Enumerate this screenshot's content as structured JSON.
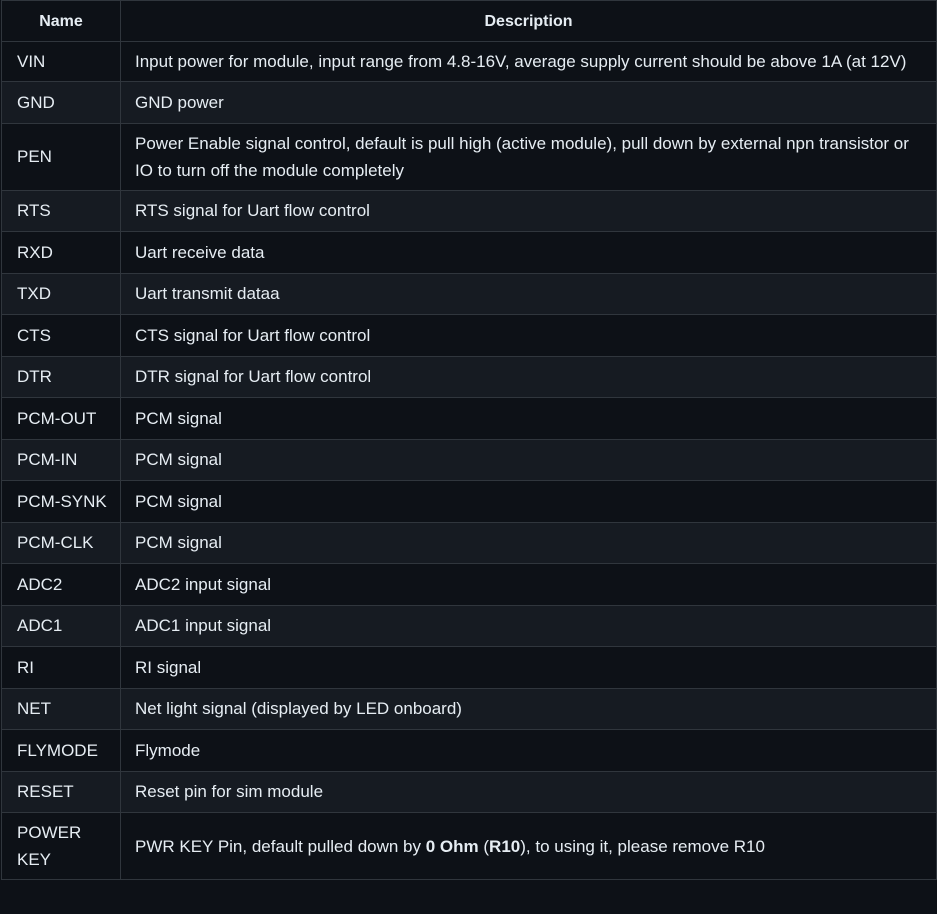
{
  "table": {
    "headers": {
      "name": "Name",
      "description": "Description"
    },
    "rows": [
      {
        "name": "VIN",
        "description": "Input power for module, input range from 4.8-16V, average supply current should be above 1A (at 12V)"
      },
      {
        "name": "GND",
        "description": "GND power"
      },
      {
        "name": "PEN",
        "description": "Power Enable signal control, default is pull high (active module), pull down by external npn transistor or IO to turn off the module completely"
      },
      {
        "name": "RTS",
        "description": "RTS signal for Uart flow control"
      },
      {
        "name": "RXD",
        "description": "Uart receive data"
      },
      {
        "name": "TXD",
        "description": "Uart transmit dataa"
      },
      {
        "name": "CTS",
        "description": "CTS signal for Uart flow control"
      },
      {
        "name": "DTR",
        "description": "DTR signal for Uart flow control"
      },
      {
        "name": "PCM-OUT",
        "description": "PCM signal"
      },
      {
        "name": "PCM-IN",
        "description": "PCM signal"
      },
      {
        "name": "PCM-SYNK",
        "description": "PCM signal"
      },
      {
        "name": "PCM-CLK",
        "description": "PCM signal"
      },
      {
        "name": "ADC2",
        "description": "ADC2 input signal"
      },
      {
        "name": "ADC1",
        "description": "ADC1 input signal"
      },
      {
        "name": "RI",
        "description": "RI signal"
      },
      {
        "name": "NET",
        "description": "Net light signal (displayed by LED onboard)"
      },
      {
        "name": "FLYMODE",
        "description": "Flymode"
      },
      {
        "name": "RESET",
        "description": "Reset pin for sim module"
      },
      {
        "name": "POWER KEY",
        "description_parts": {
          "part1": "PWR KEY Pin, default pulled down by ",
          "bold1": "0 Ohm",
          "part2": " (",
          "bold2": "R10",
          "part3": "), to using it, please remove R10"
        }
      }
    ]
  }
}
